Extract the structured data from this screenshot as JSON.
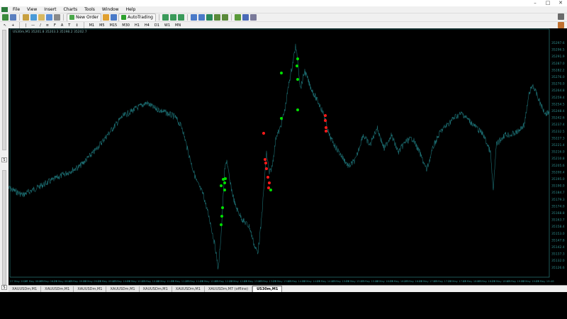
{
  "menu": [
    "File",
    "View",
    "Insert",
    "Charts",
    "Tools",
    "Window",
    "Help"
  ],
  "toolbar": {
    "new_order_label": "New Order",
    "autotrading_label": "AutoTrading"
  },
  "timeframes": [
    "M1",
    "M5",
    "M15",
    "M30",
    "H1",
    "H4",
    "D1",
    "W1",
    "MN"
  ],
  "chart": {
    "info_text": "US30m,M1  35201.8  35203.3  35198.2  35202.7",
    "line_color": "#1c6f73",
    "axis_color": "#2f8f8f",
    "buy_color": "#00e000",
    "sell_color": "#ff1a1a",
    "price_labels": [
      "35297.6",
      "35296.5",
      "35291.9",
      "35287.0",
      "35282.2",
      "35276.0",
      "35270.0",
      "35264.8",
      "35259.4",
      "35254.5",
      "35248.4",
      "35242.6",
      "35237.4",
      "35232.5",
      "35227.3",
      "35221.4",
      "35216.0",
      "35210.8",
      "35205.6",
      "35200.4",
      "35195.0",
      "35190.0",
      "35184.7",
      "35179.3",
      "35174.0",
      "35168.8",
      "35163.7",
      "35158.4",
      "35153.0",
      "35147.8",
      "35142.4",
      "35137.3",
      "35132.0",
      "35126.6"
    ],
    "time_labels": [
      "27 May 2026",
      "27 May 08:08",
      "27 May 08:28",
      "27 May 08:48",
      "27 May 09:08",
      "27 May 09:28",
      "27 May 09:48",
      "27 May 10:08",
      "27 May 10:28",
      "27 May 10:48",
      "27 May 11:08",
      "27 May 11:28",
      "27 May 11:48",
      "27 May 12:08",
      "27 May 12:28",
      "27 May 12:48",
      "27 May 13:08",
      "27 May 13:28",
      "27 May 13:48",
      "27 May 14:08",
      "27 May 14:28",
      "27 May 14:48",
      "27 May 15:08",
      "27 May 15:28",
      "27 May 15:48",
      "27 May 16:08",
      "27 May 16:28",
      "27 May 16:48",
      "27 May 17:08",
      "27 May 17:28",
      "27 May 17:48",
      "27 May 18:08",
      "27 May 18:28",
      "27 May 18:48",
      "27 May 19:08",
      "27 May 19:28",
      "27 May 19:48",
      "27 May 20:08"
    ]
  },
  "tabs": [
    {
      "label": "XAUUSDm,M1",
      "active": false
    },
    {
      "label": "XAUUSDm,M1",
      "active": false
    },
    {
      "label": "XAUUSDm,M1",
      "active": false
    },
    {
      "label": "XAUUSDm,M1",
      "active": false
    },
    {
      "label": "XAUUSDm,M1",
      "active": false
    },
    {
      "label": "XAUUSDm,M1",
      "active": false
    },
    {
      "label": "XAUUSDm,M7 (offline)",
      "active": false
    },
    {
      "label": "US30m,M1",
      "active": true
    }
  ],
  "left_labels": [
    "S",
    "S"
  ]
}
